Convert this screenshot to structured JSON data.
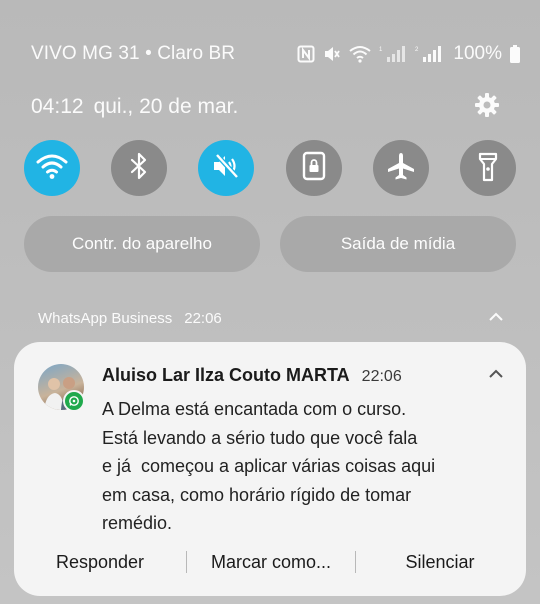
{
  "status_bar": {
    "carrier": "VIVO MG 31 • Claro BR",
    "battery": "100%",
    "icons": [
      "nfc-icon",
      "mute-icon",
      "wifi-icon",
      "signal-icon-sim1",
      "signal-icon-sim2",
      "battery-icon"
    ]
  },
  "header": {
    "time": "04:12",
    "date": "qui., 20 de mar.",
    "settings_icon": "gear-icon"
  },
  "quick_settings": [
    {
      "name": "wifi",
      "icon": "wifi-icon",
      "active": true
    },
    {
      "name": "bluetooth",
      "icon": "bluetooth-icon",
      "active": false
    },
    {
      "name": "sound",
      "icon": "mute-icon",
      "active": true
    },
    {
      "name": "lock-rotation",
      "icon": "portrait-lock-icon",
      "active": false
    },
    {
      "name": "airplane",
      "icon": "airplane-icon",
      "active": false
    },
    {
      "name": "flashlight",
      "icon": "flashlight-icon",
      "active": false
    }
  ],
  "pills": {
    "device_control": "Contr. do aparelho",
    "media_output": "Saída de mídia"
  },
  "notification": {
    "app_name": "WhatsApp Business",
    "app_time": "22:06",
    "sender": "Aluiso Lar Ilza Couto MARTA",
    "time": "22:06",
    "message_lines": [
      "A Delma está encantada com o curso.",
      "Está levando a sério tudo que você fala",
      "e já  começou a aplicar várias coisas aqui",
      "em casa, como horário rígido de tomar",
      "remédio."
    ],
    "actions": {
      "reply": "Responder",
      "mark": "Marcar como...",
      "mute": "Silenciar"
    }
  },
  "colors": {
    "accent": "#21b4e4",
    "inactive_tile": "#8a8a8a",
    "whatsapp_green": "#1fa94c",
    "card_bg": "#f4f4f4"
  }
}
